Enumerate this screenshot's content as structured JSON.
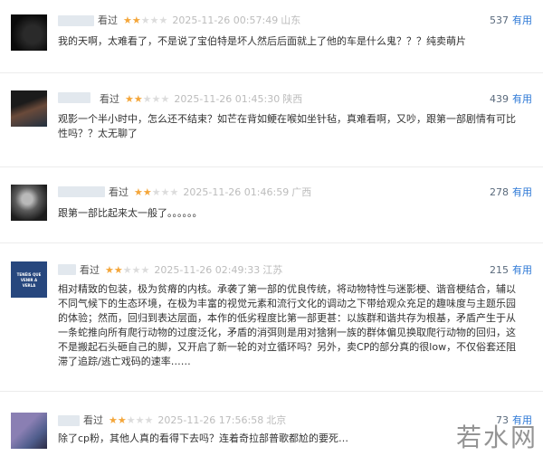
{
  "reviews": [
    {
      "status": "看过",
      "stars": 2,
      "time": "2025-11-26 00:57:49",
      "location": "山东",
      "votes": "537",
      "vote_label": "有用",
      "content": "我的天啊，太难看了，不是说了宝伯特是坏人然后后面就上了他的车是什么鬼？？？纯卖萌片"
    },
    {
      "status": "看过",
      "stars": 2,
      "time": "2025-11-26 01:45:30",
      "location": "陕西",
      "votes": "439",
      "vote_label": "有用",
      "content": "观影一个半小时中，怎么还不结束？如芒在背如鲠在喉如坐针毡，真难看啊，又吵，跟第一部剧情有可比性吗？？太无聊了"
    },
    {
      "status": "看过",
      "stars": 2,
      "time": "2025-11-26 01:46:59",
      "location": "广西",
      "votes": "278",
      "vote_label": "有用",
      "content": "跟第一部比起来太一般了。。。。。。"
    },
    {
      "status": "看过",
      "stars": 2,
      "time": "2025-11-26 02:49:33",
      "location": "江苏",
      "votes": "215",
      "vote_label": "有用",
      "avatar_text": [
        "TENÉIS QUE",
        "VENIR A",
        "VERLA"
      ],
      "content": "相对精致的包装，极为贫瘠的内核。承袭了第一部的优良传统，将动物特性与迷影梗、谐音梗结合，辅以不同气候下的生态环境，在极为丰富的视觉元素和流行文化的调动之下带给观众充足的趣味度与主题乐园的体验；然而，回归到表达层面，本作的低劣程度比第一部更甚：以族群和谐共存为根基，矛盾产生于从一条蛇推向所有爬行动物的过度泛化，矛盾的消弭则是用对猞猁一族的群体偏见换取爬行动物的回归，这不是搬起石头砸自己的脚，又开启了新一轮的对立循环吗？另外，卖CP的部分真的很low，不仅俗套还阻滞了追踪/逃亡戏码的速率……"
    },
    {
      "status": "看过",
      "stars": 2,
      "time": "2025-11-26 17:56:58",
      "location": "北京",
      "votes": "73",
      "vote_label": "有用",
      "content": "除了cp粉，其他人真的看得下去吗？连着奇拉部普歌都尬的要死…"
    }
  ],
  "watermark": "若水网",
  "colors": {
    "star_on": "#f4a63a",
    "star_off": "#dcdcdc",
    "vote_label": "#2e79d6"
  }
}
